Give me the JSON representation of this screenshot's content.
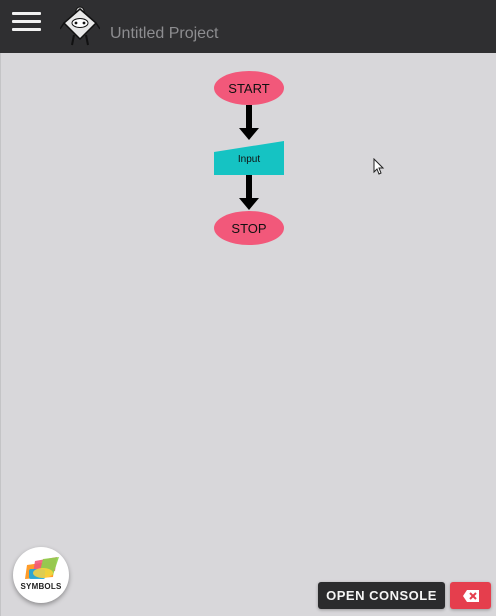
{
  "app": {
    "project_title": "Untitled Project"
  },
  "flowchart": {
    "nodes": [
      {
        "id": "start",
        "shape": "terminal",
        "label": "START",
        "color": "#f2587a"
      },
      {
        "id": "input",
        "shape": "input",
        "label": "Input",
        "color": "#15c3c3"
      },
      {
        "id": "stop",
        "shape": "terminal",
        "label": "STOP",
        "color": "#f2587a"
      }
    ],
    "arrows": [
      {
        "from": "start",
        "to": "input"
      },
      {
        "from": "input",
        "to": "stop"
      }
    ]
  },
  "buttons": {
    "symbols_label": "SYMBOLS",
    "console_label": "OPEN CONSOLE"
  },
  "icons": {
    "menu": "hamburger-menu-icon",
    "logo": "robot-logo-icon",
    "symbols": "symbols-shapes-icon",
    "clear": "backspace-x-icon",
    "cursor": "mouse-pointer-icon"
  },
  "colors": {
    "topbar": "#2f2f31",
    "canvas": "#d8d7da",
    "terminal": "#f2587a",
    "input": "#15c3c3",
    "arrow": "#000000",
    "console_button": "#2b2b2d",
    "clear_button": "#e53e4d"
  }
}
